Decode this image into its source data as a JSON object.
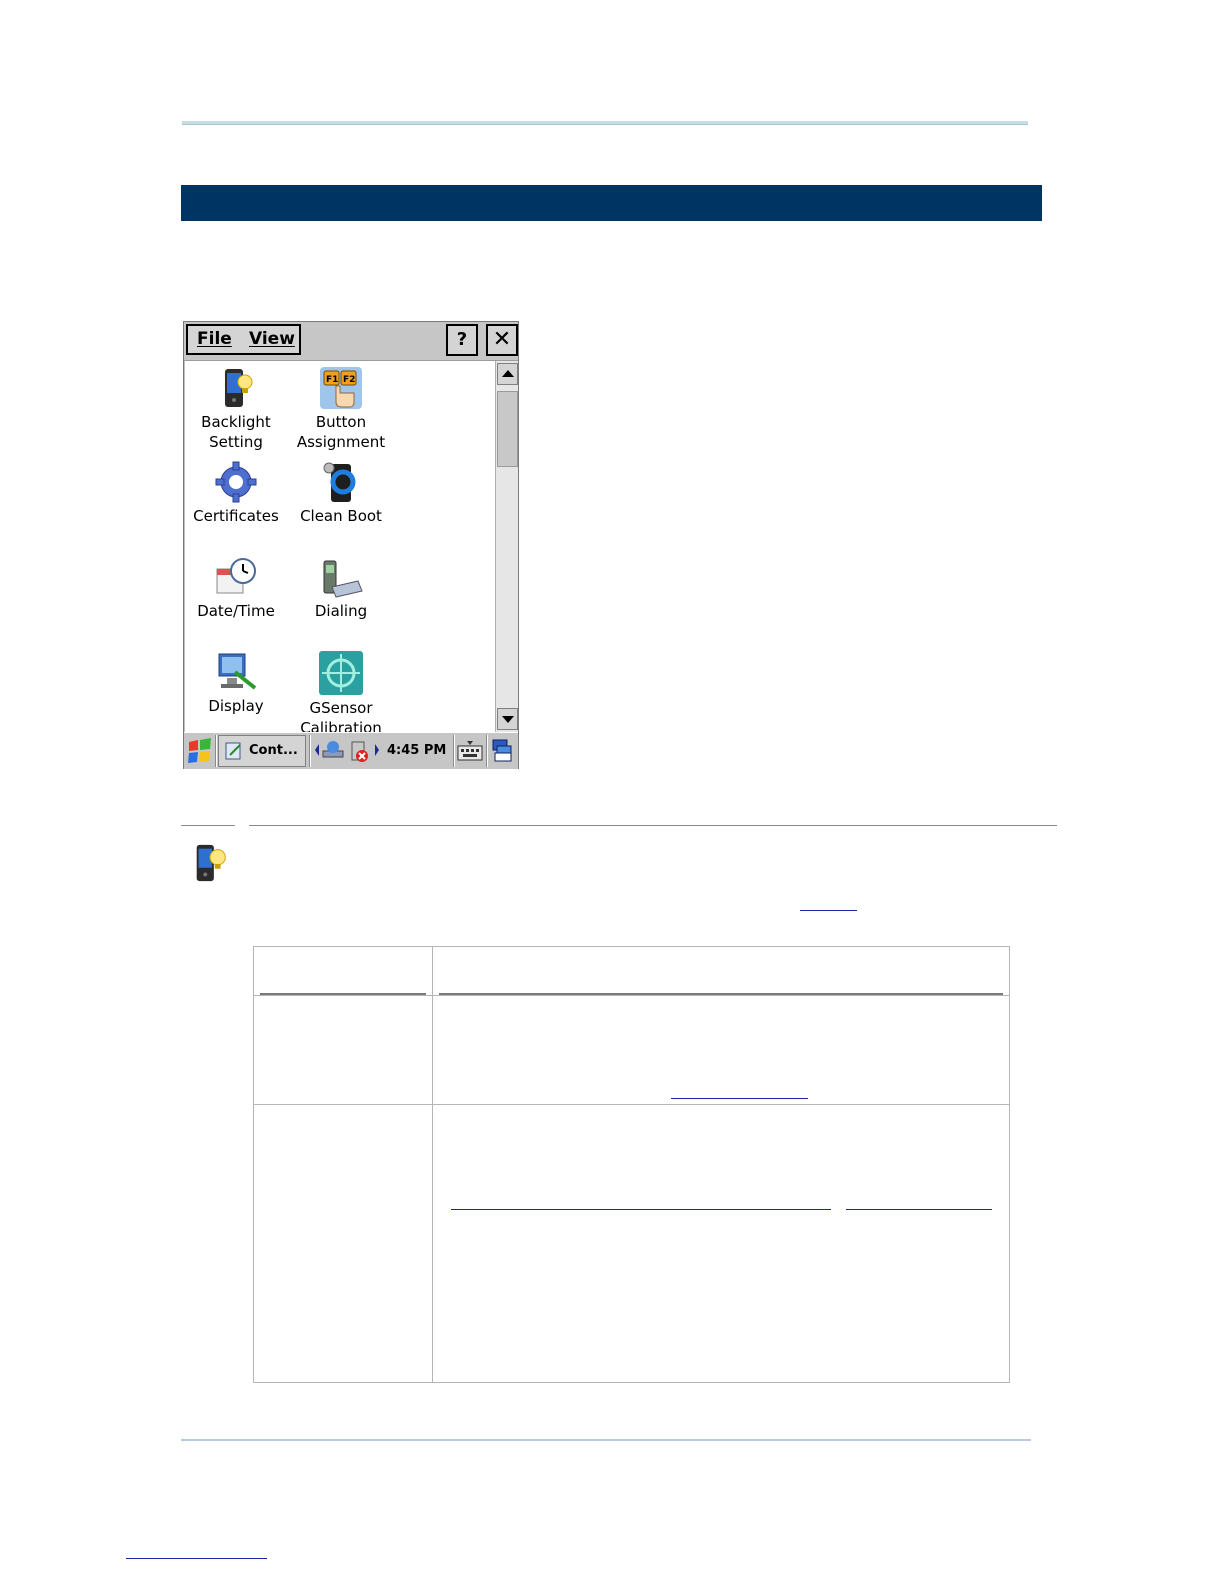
{
  "device_window": {
    "menu": {
      "file": "File",
      "view": "View"
    },
    "help_label": "?",
    "close_label": "✕",
    "items": [
      {
        "label": "Backlight\nSetting",
        "icon": "backlight-icon"
      },
      {
        "label": "Button\nAssignment",
        "icon": "button-assignment-icon",
        "icon_text": "F1 F2"
      },
      {
        "label": "Certificates",
        "icon": "certificates-gear-icon"
      },
      {
        "label": "Clean Boot",
        "icon": "clean-boot-icon"
      },
      {
        "label": "Date/Time",
        "icon": "date-time-icon"
      },
      {
        "label": "Dialing",
        "icon": "dialing-icon"
      },
      {
        "label": "Display",
        "icon": "display-icon"
      },
      {
        "label": "GSensor\nCalibration",
        "icon": "gsensor-icon"
      }
    ],
    "taskbar": {
      "task_label": "Cont...",
      "clock": "4:45 PM"
    }
  },
  "colors": {
    "section_band": "#003462",
    "top_rule": "#c6dde4",
    "link": "#1a2aa0"
  }
}
